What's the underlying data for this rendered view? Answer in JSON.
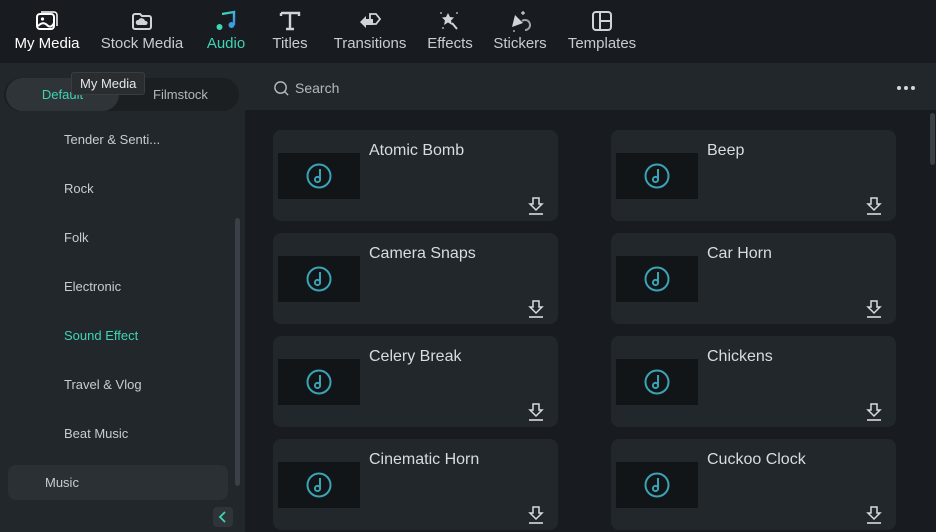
{
  "toolbar": {
    "tabs": [
      {
        "label": "My Media",
        "icon": "my-media-icon"
      },
      {
        "label": "Stock Media",
        "icon": "stock-media-icon"
      },
      {
        "label": "Audio",
        "icon": "music-note-icon"
      },
      {
        "label": "Titles",
        "icon": "titles-icon"
      },
      {
        "label": "Transitions",
        "icon": "transitions-icon"
      },
      {
        "label": "Effects",
        "icon": "effects-icon"
      },
      {
        "label": "Stickers",
        "icon": "stickers-icon"
      },
      {
        "label": "Templates",
        "icon": "templates-icon"
      }
    ],
    "active_tab": "Audio"
  },
  "tooltip": "My Media",
  "sidebar": {
    "segments": [
      "Default",
      "Filmstock"
    ],
    "active_segment": "Default",
    "categories": [
      {
        "label": "Tender & Senti..."
      },
      {
        "label": "Rock"
      },
      {
        "label": "Folk"
      },
      {
        "label": "Electronic"
      },
      {
        "label": "Sound Effect"
      },
      {
        "label": "Travel & Vlog"
      },
      {
        "label": "Beat Music"
      }
    ],
    "active_category": "Sound Effect",
    "parent_item": "Music"
  },
  "search": {
    "placeholder": "Search"
  },
  "colors": {
    "accent": "#3fd4b4",
    "icon_teal": "#3aa3b5"
  },
  "items": [
    {
      "title": "Atomic Bomb"
    },
    {
      "title": "Beep"
    },
    {
      "title": "Camera Snaps"
    },
    {
      "title": "Car Horn"
    },
    {
      "title": "Celery Break"
    },
    {
      "title": "Chickens"
    },
    {
      "title": "Cinematic Horn"
    },
    {
      "title": "Cuckoo Clock"
    }
  ]
}
